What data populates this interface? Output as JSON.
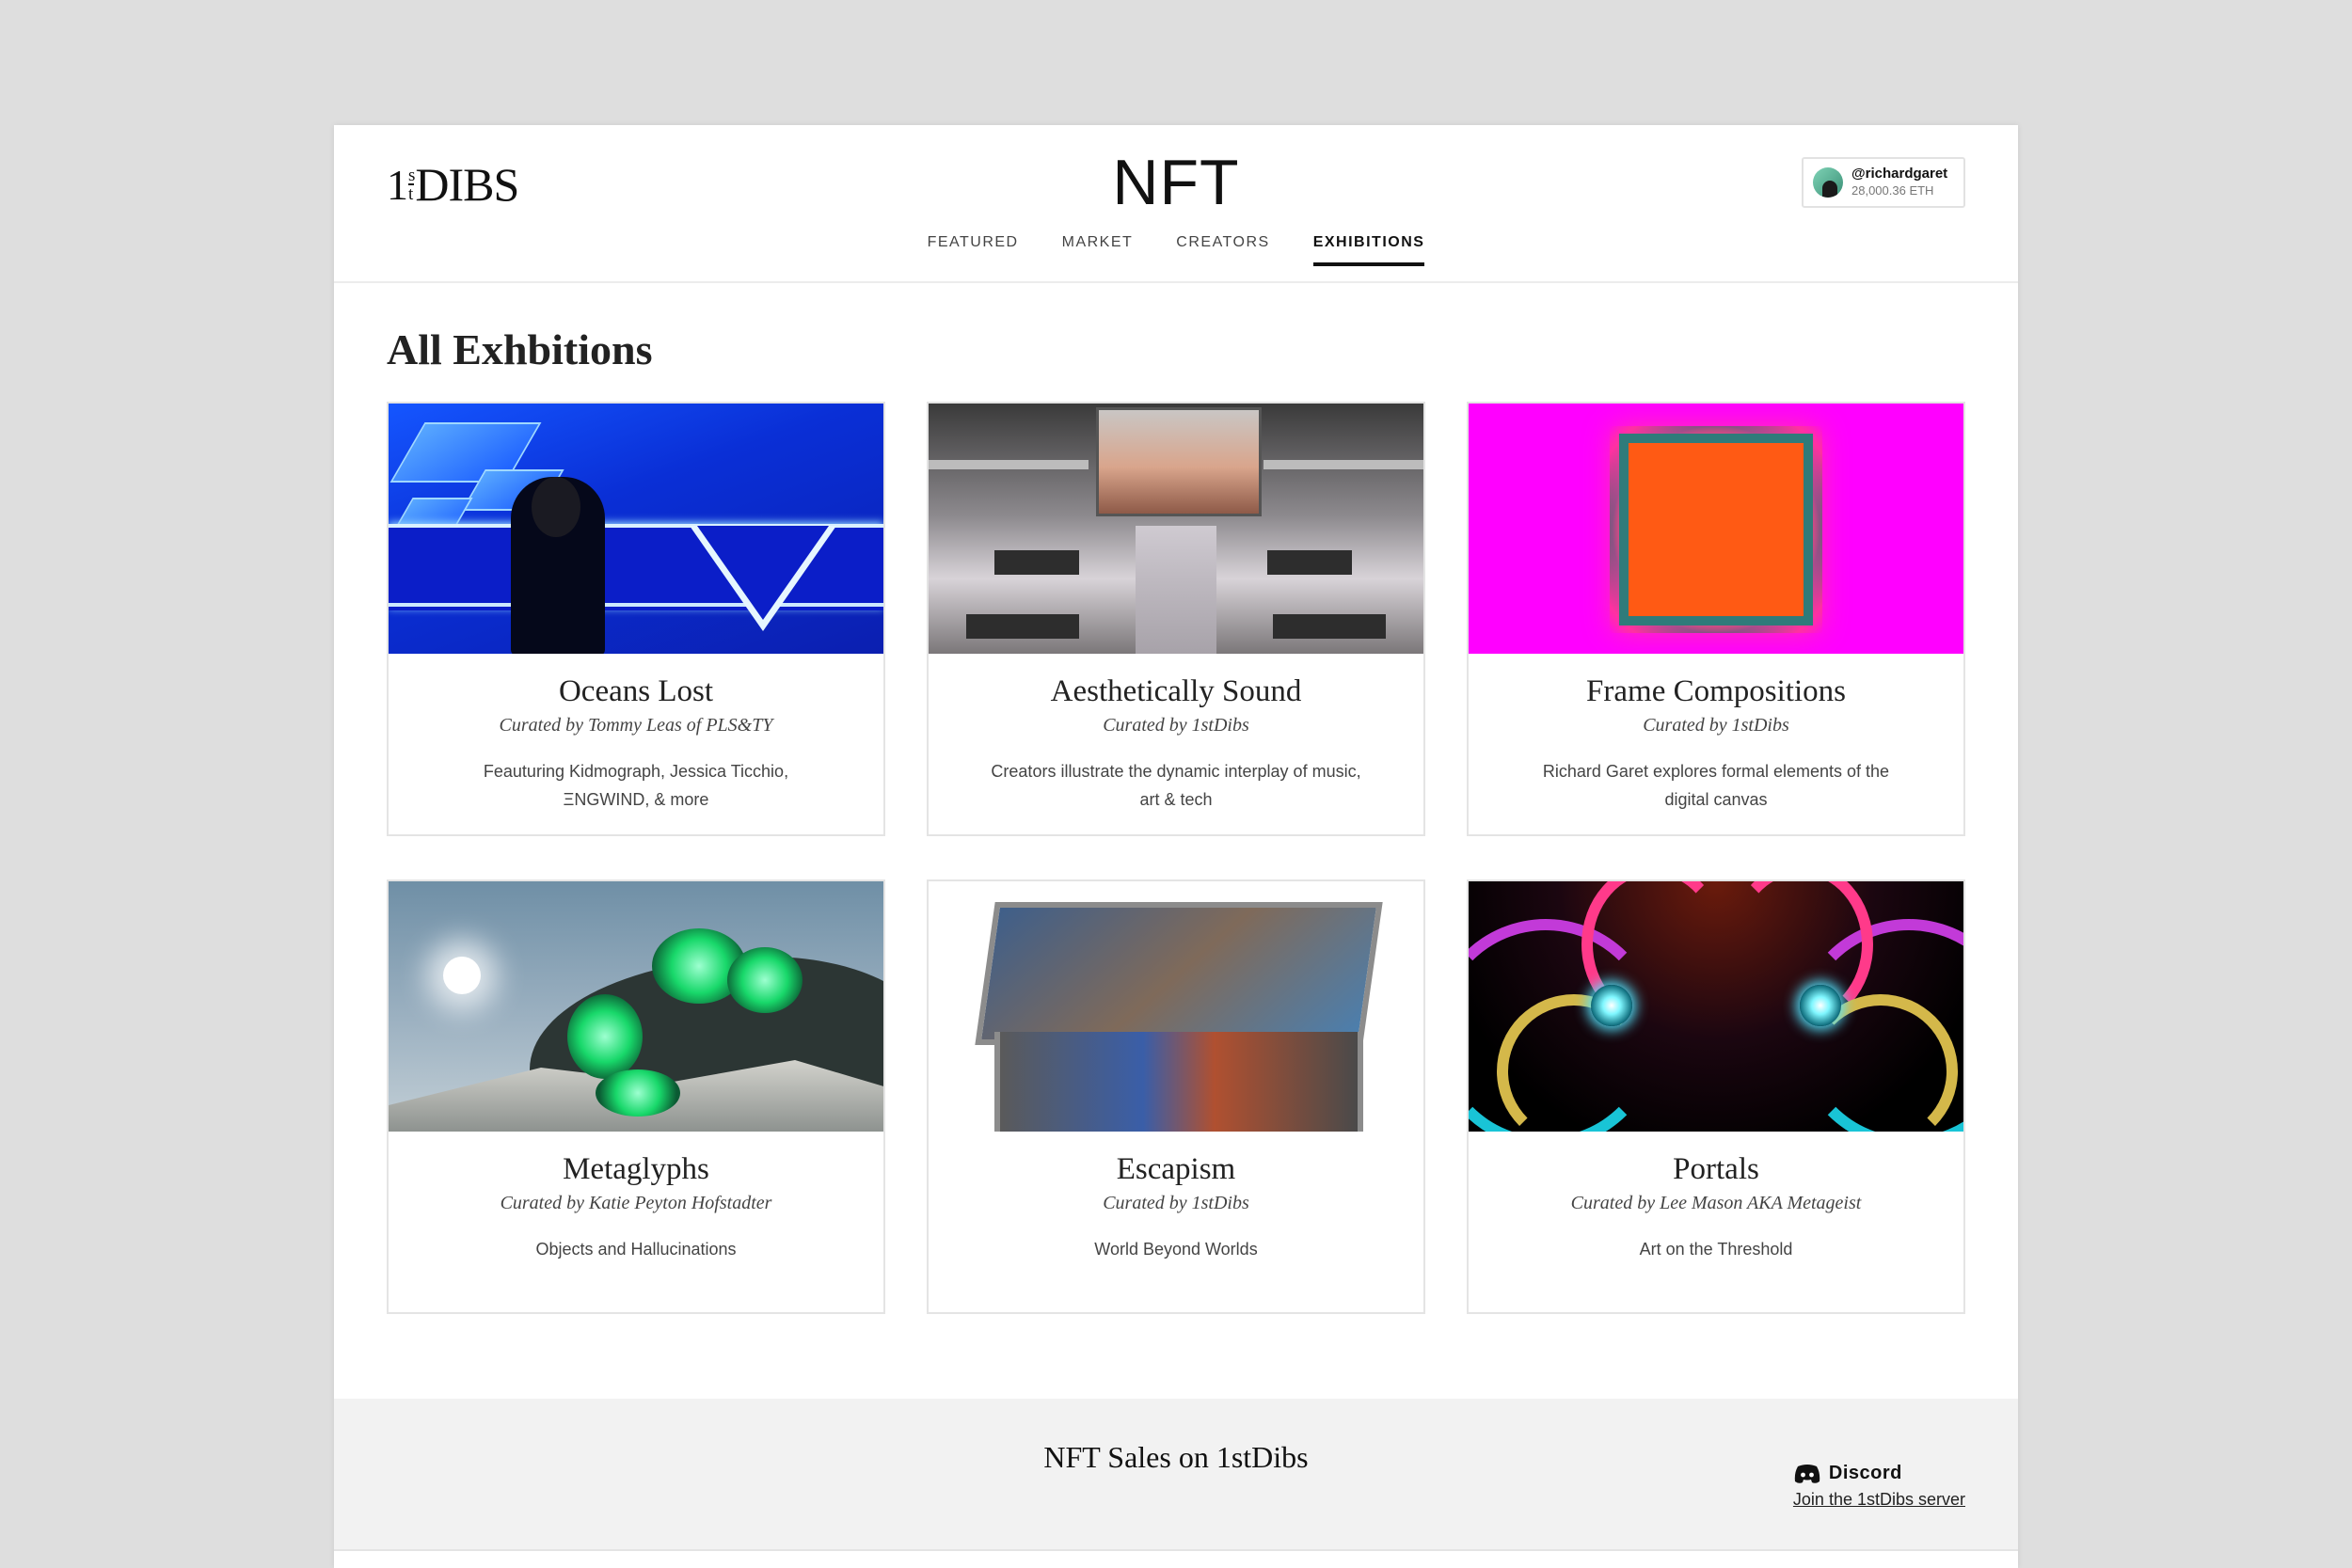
{
  "header": {
    "logo": {
      "num": "1",
      "sup": "s",
      "sub": "t",
      "word": "DIBS"
    },
    "title": "NFT",
    "nav": [
      {
        "label": "FEATURED",
        "active": false
      },
      {
        "label": "MARKET",
        "active": false
      },
      {
        "label": "CREATORS",
        "active": false
      },
      {
        "label": "EXHIBITIONS",
        "active": true
      }
    ],
    "user": {
      "handle": "@richardgaret",
      "balance": "28,000.36 ETH"
    }
  },
  "main": {
    "heading": "All Exhbitions",
    "exhibitions": [
      {
        "title": "Oceans Lost",
        "curator": "Curated by Tommy Leas of PLS&TY",
        "description": "Feauturing Kidmograph, Jessica Ticchio, ΞNGWIND, & more"
      },
      {
        "title": "Aesthetically Sound",
        "curator": "Curated by 1stDibs",
        "description": "Creators illustrate the dynamic interplay of music, art & tech"
      },
      {
        "title": "Frame Compositions",
        "curator": "Curated by 1stDibs",
        "description": "Richard Garet explores formal elements of the digital canvas"
      },
      {
        "title": "Metaglyphs",
        "curator": "Curated by Katie Peyton Hofstadter",
        "description": "Objects and Hallucinations"
      },
      {
        "title": "Escapism",
        "curator": "Curated by 1stDibs",
        "description": "World Beyond Worlds"
      },
      {
        "title": "Portals",
        "curator": "Curated by Lee Mason AKA Metageist",
        "description": "Art on the Threshold"
      }
    ]
  },
  "footer": {
    "title": "NFT Sales on 1stDibs",
    "discord": {
      "label": "Discord",
      "link": "Join the 1stDibs server"
    }
  },
  "colors": {
    "accent": "#111111",
    "background": "#dedede",
    "footer_bg": "#f2f2f2"
  }
}
